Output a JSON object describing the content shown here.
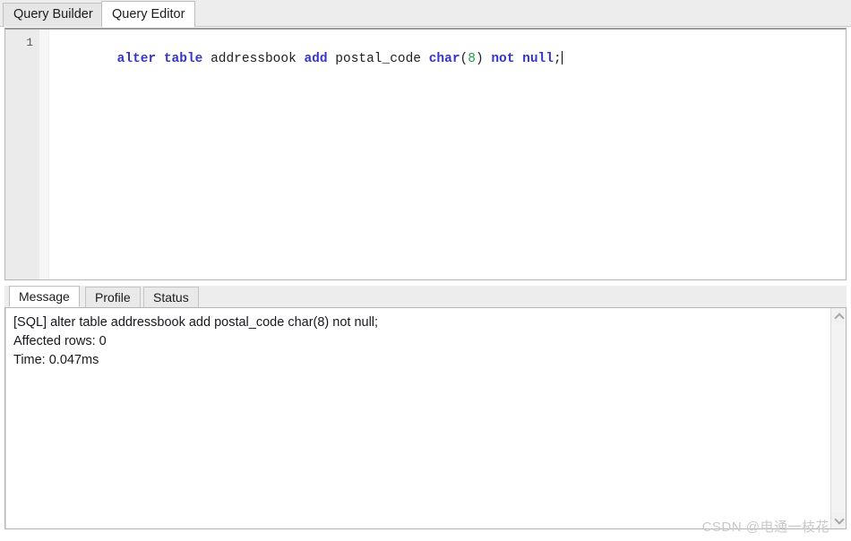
{
  "top_tabs": [
    {
      "id": "query-builder",
      "label": "Query Builder",
      "active": false
    },
    {
      "id": "query-editor",
      "label": "Query Editor",
      "active": true
    }
  ],
  "editor": {
    "line_number": "1",
    "sql_text": "alter table addressbook add postal_code char(8) not null;",
    "tokens": [
      {
        "text": "alter",
        "type": "keyword"
      },
      {
        "text": " ",
        "type": "plain"
      },
      {
        "text": "table",
        "type": "keyword"
      },
      {
        "text": " ",
        "type": "plain"
      },
      {
        "text": "addressbook",
        "type": "identifier"
      },
      {
        "text": " ",
        "type": "plain"
      },
      {
        "text": "add",
        "type": "keyword"
      },
      {
        "text": " ",
        "type": "plain"
      },
      {
        "text": "postal_code",
        "type": "identifier"
      },
      {
        "text": " ",
        "type": "plain"
      },
      {
        "text": "char",
        "type": "keyword"
      },
      {
        "text": "(",
        "type": "punctuation"
      },
      {
        "text": "8",
        "type": "number"
      },
      {
        "text": ")",
        "type": "punctuation"
      },
      {
        "text": " ",
        "type": "plain"
      },
      {
        "text": "not",
        "type": "keyword"
      },
      {
        "text": " ",
        "type": "plain"
      },
      {
        "text": "null",
        "type": "keyword"
      },
      {
        "text": ";",
        "type": "punctuation"
      }
    ],
    "colors": {
      "keyword": "#3535cc",
      "identifier": "#202020",
      "number": "#1f9f3c",
      "punctuation": "#202020",
      "background": "#ffffff",
      "gutter": "#ebebeb"
    }
  },
  "bottom_tabs": [
    {
      "id": "message",
      "label": "Message",
      "active": true
    },
    {
      "id": "profile",
      "label": "Profile",
      "active": false
    },
    {
      "id": "status",
      "label": "Status",
      "active": false
    }
  ],
  "message_panel": {
    "lines": [
      "[SQL] alter table addressbook add postal_code char(8) not null;",
      "Affected rows: 0",
      "Time: 0.047ms"
    ],
    "scrollbar": {
      "up_arrow_icon": "chevron-up-icon",
      "down_arrow_icon": "chevron-down-icon"
    }
  },
  "watermark": {
    "text": "CSDN @电通一枝花"
  }
}
